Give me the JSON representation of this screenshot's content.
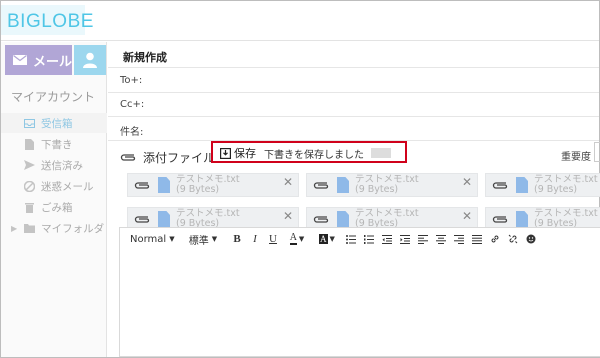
{
  "header": {
    "logo_text": "BIGLOBE"
  },
  "sidebar": {
    "mail_button": "メール",
    "account_label": "マイアカウント",
    "items": [
      {
        "label": "受信箱",
        "icon": "inbox-icon",
        "active": true
      },
      {
        "label": "下書き",
        "icon": "draft-icon",
        "active": false
      },
      {
        "label": "送信済み",
        "icon": "sent-icon",
        "active": false
      },
      {
        "label": "迷惑メール",
        "icon": "spam-icon",
        "active": false
      },
      {
        "label": "ごみ箱",
        "icon": "trash-icon",
        "active": false
      },
      {
        "label": "マイフォルダ",
        "icon": "folder-icon",
        "active": false
      }
    ]
  },
  "compose": {
    "title": "新規作成",
    "to_label": "To+:",
    "cc_label": "Cc+:",
    "subject_label": "件名:",
    "attach_label": "添付ファイル",
    "save_label": "保存",
    "save_message": "下書きを保存しました",
    "importance_label": "重要度"
  },
  "attachments": [
    {
      "name": "テストメモ.txt",
      "size": "(9 Bytes)"
    },
    {
      "name": "テストメモ.txt",
      "size": "(9 Bytes)"
    },
    {
      "name": "テストメモ.txt",
      "size": "(9 Bytes)"
    },
    {
      "name": "テストメモ.txt",
      "size": "(9 Bytes)"
    },
    {
      "name": "テストメモ.txt",
      "size": "(9 Bytes)"
    },
    {
      "name": "テストメモ.txt",
      "size": "(9 Bytes)"
    }
  ],
  "toolbar": {
    "format_select": "Normal",
    "font_size_select": "標準",
    "bold": "B",
    "italic": "I",
    "underline": "U",
    "font_color": "A",
    "bg_color": "A"
  },
  "colors": {
    "accent_purple": "#b1a6d6",
    "accent_blue": "#9cd7ee",
    "highlight_red": "#d0011b"
  }
}
